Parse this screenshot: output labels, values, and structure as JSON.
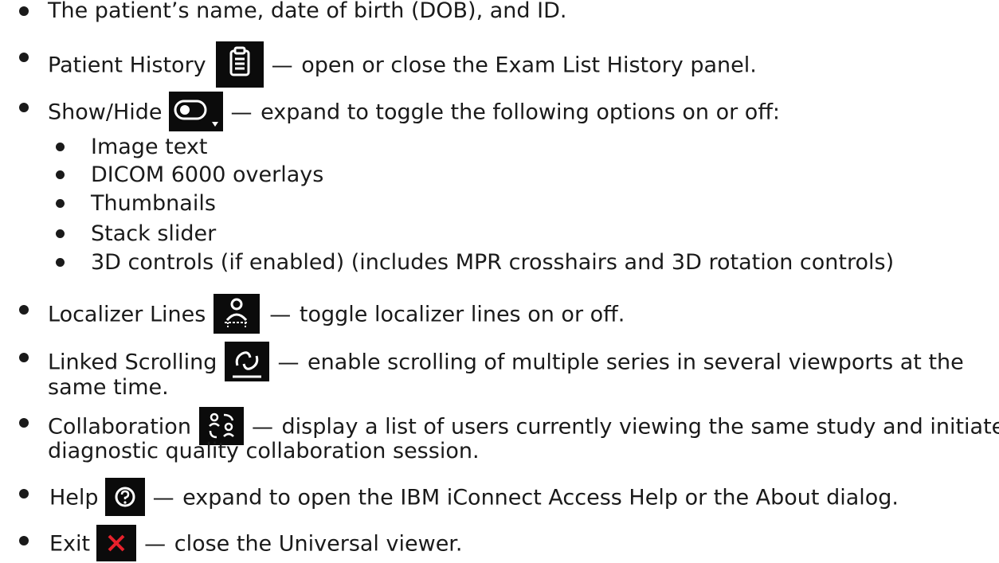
{
  "items": [
    {
      "text": "The patient’s name, date of birth (DOB), and ID."
    },
    {
      "label": "Patient History",
      "icon": "clipboard-icon",
      "desc": "open or close the Exam List History panel."
    },
    {
      "label": "Show/Hide",
      "icon": "toggle-icon",
      "desc": "expand to toggle the following options on or off:"
    },
    {
      "label": "Localizer Lines",
      "icon": "localizer-icon",
      "desc": "toggle localizer lines on or off."
    },
    {
      "label": "Linked Scrolling",
      "icon": "link-icon",
      "desc": "enable scrolling of multiple series in several viewports at the",
      "desc2": "same time."
    },
    {
      "label": "Collaboration",
      "icon": "collaboration-icon",
      "desc": "display a list of users currently viewing the same study and initiate a",
      "desc2": "diagnostic quality collaboration session."
    },
    {
      "label": "Help",
      "icon": "help-icon",
      "desc": "expand to open the IBM iConnect Access Help or the About dialog."
    },
    {
      "label": "Exit",
      "icon": "close-icon",
      "desc": "close the Universal viewer."
    }
  ],
  "subitems": [
    "Image text",
    "DICOM 6000 overlays",
    "Thumbnails",
    "Stack slider",
    "3D controls (if enabled) (includes MPR crosshairs and 3D rotation controls)"
  ],
  "dash": "—",
  "colors": {
    "icon_bg": "#0b0b0b",
    "exit_x": "#e8212b",
    "text": "#1a1a1a"
  }
}
